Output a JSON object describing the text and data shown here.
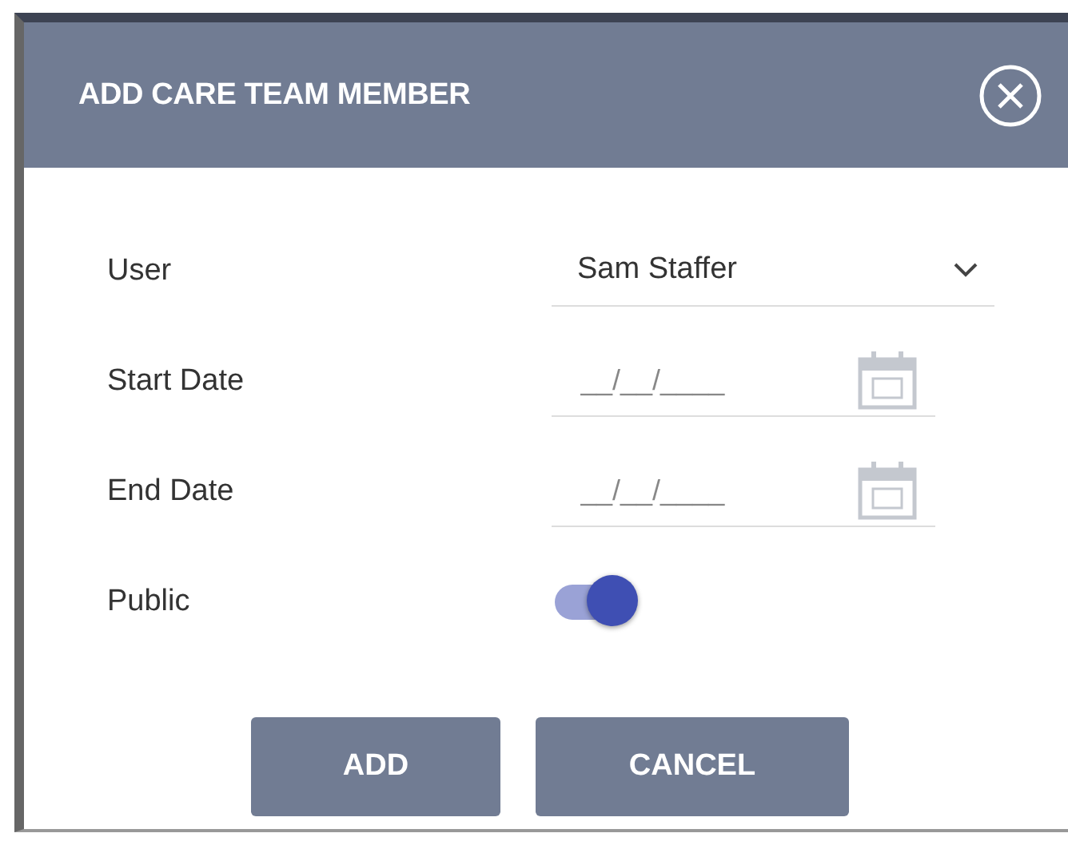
{
  "dialog": {
    "title": "ADD CARE TEAM MEMBER"
  },
  "fields": [
    {
      "kind": "select",
      "label": "User",
      "value": "Sam Staffer"
    },
    {
      "kind": "date",
      "label": "Start Date",
      "placeholder": "__/__/____"
    },
    {
      "kind": "date",
      "label": "End Date",
      "placeholder": "__/__/____"
    },
    {
      "kind": "toggle",
      "label": "Public",
      "on": true
    }
  ],
  "buttons": [
    "ADD",
    "CANCEL"
  ]
}
